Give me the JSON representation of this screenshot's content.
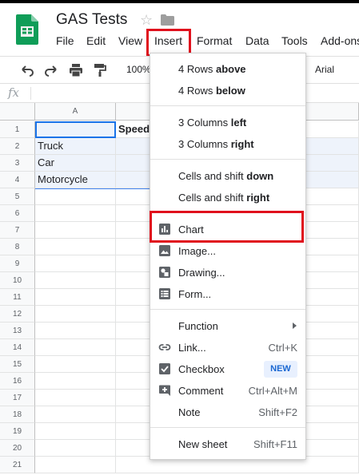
{
  "app": {
    "title": "GAS Tests",
    "brand_color": "#0f9d58",
    "highlight_color": "#e0111d"
  },
  "menubar": [
    {
      "label": "File"
    },
    {
      "label": "Edit"
    },
    {
      "label": "View"
    },
    {
      "label": "Insert"
    },
    {
      "label": "Format"
    },
    {
      "label": "Data"
    },
    {
      "label": "Tools"
    },
    {
      "label": "Add-ons"
    }
  ],
  "toolbar": {
    "zoom": "100%",
    "font": "Arial",
    "icons": [
      "undo-icon",
      "redo-icon",
      "print-icon",
      "paint-format-icon"
    ]
  },
  "formula_bar": {
    "fx": "fx",
    "value": ""
  },
  "sheet": {
    "columns": [
      "A"
    ],
    "rows": [
      "1",
      "2",
      "3",
      "4",
      "5",
      "6",
      "7",
      "8",
      "9",
      "10",
      "11",
      "12",
      "13",
      "14",
      "15",
      "16",
      "17",
      "18",
      "19",
      "20",
      "21"
    ],
    "cells": {
      "A1": "",
      "B1": "Speed",
      "A2": "Truck",
      "A3": "Car",
      "A4": "Motorcycle"
    }
  },
  "insert_menu": {
    "rows_above": {
      "pre": "4 Rows ",
      "bold": "above"
    },
    "rows_below": {
      "pre": "4 Rows ",
      "bold": "below"
    },
    "cols_left": {
      "pre": "3 Columns ",
      "bold": "left"
    },
    "cols_right": {
      "pre": "3 Columns ",
      "bold": "right"
    },
    "shift_down": {
      "pre": "Cells and shift ",
      "bold": "down"
    },
    "shift_right": {
      "pre": "Cells and shift ",
      "bold": "right"
    },
    "chart": "Chart",
    "image": "Image...",
    "drawing": "Drawing...",
    "form": "Form...",
    "function": "Function",
    "link": {
      "label": "Link...",
      "shortcut": "Ctrl+K"
    },
    "checkbox": {
      "label": "Checkbox",
      "badge": "NEW"
    },
    "comment": {
      "label": "Comment",
      "shortcut": "Ctrl+Alt+M"
    },
    "note": {
      "label": "Note",
      "shortcut": "Shift+F2"
    },
    "new_sheet": {
      "label": "New sheet",
      "shortcut": "Shift+F11"
    }
  }
}
